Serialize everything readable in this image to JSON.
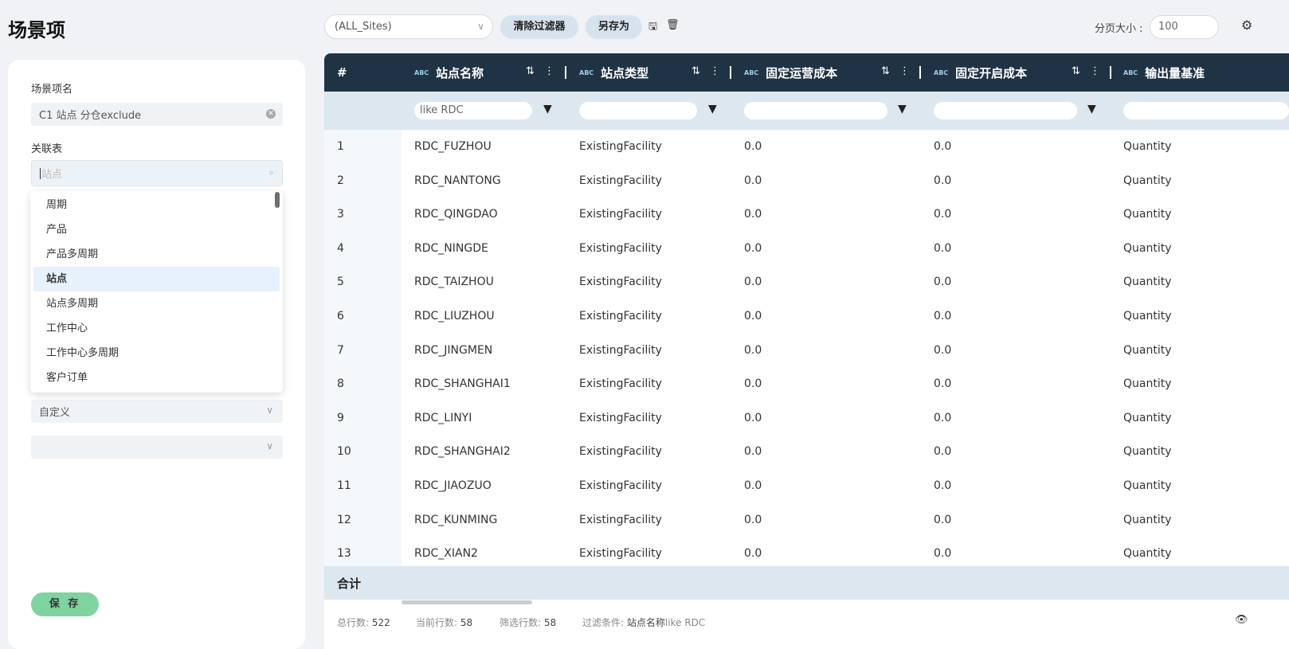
{
  "page": {
    "title": "场景项"
  },
  "left_panel": {
    "name_label": "场景项名",
    "name_value": "C1 站点 分仓exclude",
    "table_label": "关联表",
    "table_search_placeholder": "站点",
    "dropdown_items": [
      "周期",
      "产品",
      "产品多周期",
      "站点",
      "站点多周期",
      "工作中心",
      "工作中心多周期",
      "客户订单"
    ],
    "dropdown_selected": "站点",
    "type_select_value": "自定义",
    "extra_select_value": "",
    "save_label": "保 存"
  },
  "toolbar": {
    "site_select_value": "(ALL_Sites)",
    "clear_filter_label": "清除过滤器",
    "save_as_label": "另存为",
    "page_size_label": "分页大小 :",
    "page_size_value": "100"
  },
  "grid": {
    "index_header": "#",
    "type_tag": "ABC",
    "columns": [
      {
        "label": "站点名称",
        "filter": "like RDC"
      },
      {
        "label": "站点类型",
        "filter": ""
      },
      {
        "label": "固定运营成本",
        "filter": ""
      },
      {
        "label": "固定开启成本",
        "filter": ""
      },
      {
        "label": "输出量基准",
        "filter": ""
      }
    ],
    "rows": [
      [
        "1",
        "RDC_FUZHOU",
        "ExistingFacility",
        "0.0",
        "0.0",
        "Quantity"
      ],
      [
        "2",
        "RDC_NANTONG",
        "ExistingFacility",
        "0.0",
        "0.0",
        "Quantity"
      ],
      [
        "3",
        "RDC_QINGDAO",
        "ExistingFacility",
        "0.0",
        "0.0",
        "Quantity"
      ],
      [
        "4",
        "RDC_NINGDE",
        "ExistingFacility",
        "0.0",
        "0.0",
        "Quantity"
      ],
      [
        "5",
        "RDC_TAIZHOU",
        "ExistingFacility",
        "0.0",
        "0.0",
        "Quantity"
      ],
      [
        "6",
        "RDC_LIUZHOU",
        "ExistingFacility",
        "0.0",
        "0.0",
        "Quantity"
      ],
      [
        "7",
        "RDC_JINGMEN",
        "ExistingFacility",
        "0.0",
        "0.0",
        "Quantity"
      ],
      [
        "8",
        "RDC_SHANGHAI1",
        "ExistingFacility",
        "0.0",
        "0.0",
        "Quantity"
      ],
      [
        "9",
        "RDC_LINYI",
        "ExistingFacility",
        "0.0",
        "0.0",
        "Quantity"
      ],
      [
        "10",
        "RDC_SHANGHAI2",
        "ExistingFacility",
        "0.0",
        "0.0",
        "Quantity"
      ],
      [
        "11",
        "RDC_JIAOZUO",
        "ExistingFacility",
        "0.0",
        "0.0",
        "Quantity"
      ],
      [
        "12",
        "RDC_KUNMING",
        "ExistingFacility",
        "0.0",
        "0.0",
        "Quantity"
      ],
      [
        "13",
        "RDC_XIAN2",
        "ExistingFacility",
        "0.0",
        "0.0",
        "Quantity"
      ]
    ],
    "total_label": "合计"
  },
  "status": {
    "total_rows_label": "总行数:",
    "total_rows_value": "522",
    "current_rows_label": "当前行数:",
    "current_rows_value": "58",
    "filtered_rows_label": "筛选行数:",
    "filtered_rows_value": "58",
    "filter_cond_label": "过滤条件:",
    "filter_cond_field": "站点名称",
    "filter_cond_expr": "like RDC"
  },
  "icons": [
    "chevron-down-icon",
    "save-icon",
    "delete-icon",
    "gear-icon",
    "sort-icon",
    "menu-icon",
    "filter-icon",
    "search-icon",
    "clear-icon",
    "eye-off-icon"
  ]
}
